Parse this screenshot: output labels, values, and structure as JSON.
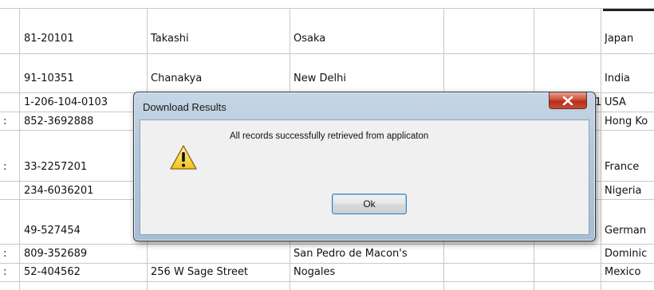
{
  "table": {
    "rows": [
      {
        "prefix": "",
        "phone": "81-20101",
        "name": "Takashi",
        "city": "Osaka",
        "extra": "",
        "country": "Japan"
      },
      {
        "prefix": "",
        "phone": "91-10351",
        "name": "Chanakya",
        "city": "New Delhi",
        "extra": "",
        "country": "India"
      },
      {
        "prefix": "",
        "phone": "1-206-104-0103",
        "name": "",
        "city": "",
        "extra": "1",
        "country": "USA"
      },
      {
        "prefix": ":",
        "phone": "852-3692888",
        "name": "",
        "city": "",
        "extra": "",
        "country": "Hong Ko"
      },
      {
        "prefix": ":",
        "phone": "33-2257201",
        "name": "",
        "city": "",
        "extra": "",
        "country": "France"
      },
      {
        "prefix": "",
        "phone": "234-6036201",
        "name": "",
        "city": "",
        "extra": "",
        "country": "Nigeria"
      },
      {
        "prefix": "",
        "phone": "49-527454",
        "name": "",
        "city": "",
        "extra": "",
        "country": "German"
      },
      {
        "prefix": ":",
        "phone": "809-352689",
        "name": "",
        "city": "San Pedro de Macon's",
        "extra": "",
        "country": "Dominic"
      },
      {
        "prefix": ":",
        "phone": "52-404562",
        "name": "256 W Sage Street",
        "city": "Nogales",
        "extra": "",
        "country": "Mexico"
      }
    ]
  },
  "dialog": {
    "title": "Download Results",
    "message": "All records successfully retrieved from applicaton",
    "ok_label": "Ok",
    "close_glyph": "x"
  },
  "colors": {
    "close_button": "#c94a33",
    "warning_fill": "#f7d23a",
    "title_bar": "#b4c7da"
  }
}
